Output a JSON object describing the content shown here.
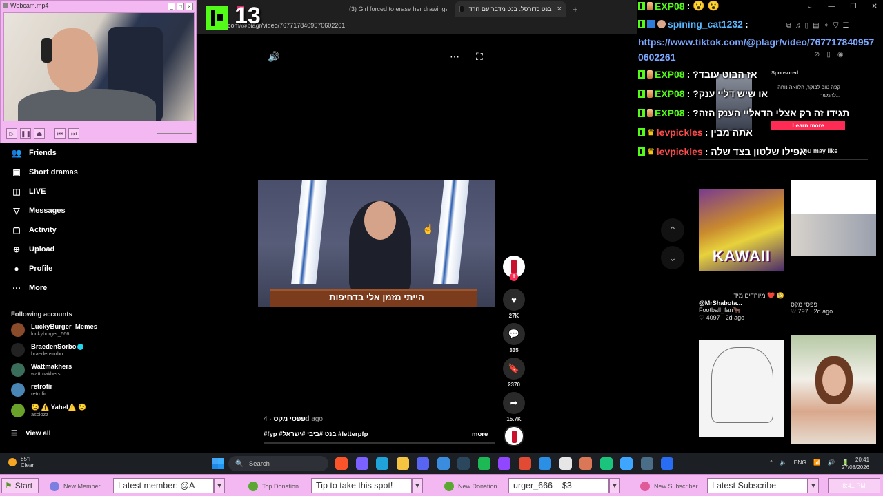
{
  "browser": {
    "tabs": [
      {
        "title": "(3) Girl forced to erase her drawings"
      },
      {
        "title": "בנט כדורסל: בנט מדבר עם חרדי"
      }
    ],
    "url": "com/@plagr/video/7677178409570602261",
    "window_controls": [
      "⌄",
      "—",
      "❐",
      "✕"
    ]
  },
  "stream_overlay": {
    "viewer_count": "13"
  },
  "webcam": {
    "title": "Webcam.mp4",
    "controls": [
      "▷",
      "❚❚",
      "⏏",
      "⏮",
      "⏭"
    ]
  },
  "sidebar": {
    "items": [
      {
        "label": "Friends",
        "icon": "friends-icon",
        "glyph": "👥"
      },
      {
        "label": "Short dramas",
        "icon": "short-dramas-icon",
        "glyph": "▣"
      },
      {
        "label": "LIVE",
        "icon": "live-icon",
        "glyph": "◫"
      },
      {
        "label": "Messages",
        "icon": "messages-icon",
        "glyph": "▽"
      },
      {
        "label": "Activity",
        "icon": "activity-icon",
        "glyph": "▢"
      },
      {
        "label": "Upload",
        "icon": "upload-icon",
        "glyph": "⊕"
      },
      {
        "label": "Profile",
        "icon": "profile-icon",
        "glyph": "●"
      },
      {
        "label": "More",
        "icon": "more-icon",
        "glyph": "⋯"
      }
    ],
    "following_title": "Following accounts",
    "accounts": [
      {
        "name": "LuckyBurger_Memes",
        "handle": "luckyburger_666",
        "color": "#8a4b2a"
      },
      {
        "name": "BraedenSorbo",
        "handle": "braedensorbo",
        "color": "#222222"
      },
      {
        "name": "Wattmakhers",
        "handle": "wattmakhers",
        "color": "#3b6e5a"
      },
      {
        "name": "retrofir",
        "handle": "retrofir",
        "color": "#4a86b5"
      },
      {
        "name": "😉 ⚠️ Yahel⚠️ 😉",
        "handle": "asclozz",
        "color": "#6aa32a"
      }
    ],
    "view_all": "View all",
    "view_all_glyph": "☰"
  },
  "video": {
    "caption_overlay": "הייתי מזמן אלי בדחיפות",
    "author": "פפסי מקס",
    "age": " · 4d ago",
    "tags": "#fyp #בנט #ביבי #ישראל #letterpfp",
    "more": "more",
    "top_icons": {
      "volume": "🔊",
      "options": "⋯",
      "fullscreen": "⛶"
    },
    "rail": {
      "follow_plus": "+",
      "like": {
        "glyph": "♥",
        "count": "27K"
      },
      "comment": {
        "glyph": "💬",
        "count": "335"
      },
      "save": {
        "glyph": "🔖",
        "count": "2370"
      },
      "share": {
        "glyph": "➦",
        "count": "15.7K"
      }
    },
    "nav": {
      "up": "⌃",
      "down": "⌄"
    }
  },
  "right_panel": {
    "sponsored": "Sponsored",
    "ad_text": "קפה טוב לבוקר, הלוואה נוחה להמשך...",
    "learn_more": "Learn more",
    "you_may_like": "You may like",
    "cards": [
      {
        "creator": "מיוחדים מידי ❤️ 🥹",
        "handle": "@MrShabota...",
        "sub": "Football_fan🐂",
        "likes": "4097",
        "age": "2d ago"
      },
      {
        "creator": "פפסי מקס",
        "likes": "797",
        "age": "2d ago"
      }
    ],
    "thumb_titles": {
      "kawaii": "KAWAII"
    }
  },
  "chat": {
    "url": "https://www.tiktok.com/@plagr/video/7677178409570602261",
    "messages": [
      {
        "user": "EXP08",
        "text": ": 😮 😮",
        "user_class": "u-exp",
        "badge": "sub"
      },
      {
        "user": "spining_cat1232",
        "text": ":",
        "user_class": "u-cat",
        "badge": "x"
      },
      {
        "user": "EXP08",
        "text": ": ?אז הבוט עובד",
        "user_class": "u-exp",
        "badge": "sub"
      },
      {
        "user": "EXP08",
        "text": ": ?או שיש דליי ענק",
        "user_class": "u-exp",
        "badge": "sub"
      },
      {
        "user": "EXP08",
        "text": ": ?תגידו זה רק אצלי הדאליי הענק הזה",
        "user_class": "u-exp",
        "badge": "sub"
      },
      {
        "user": "levpickles",
        "text": ": אתה מבין",
        "user_class": "u-lev",
        "badge": "crown"
      },
      {
        "user": "levpickles",
        "text": ": אפילו שלטון בצד שלה",
        "user_class": "u-lev",
        "badge": "crown"
      }
    ]
  },
  "taskbar": {
    "temp": "85°F",
    "weather": "Clear",
    "search": "Search",
    "search_glyph": "🔍",
    "tray_items": [
      "^",
      "🔈",
      "ENG",
      "📶",
      "🔊",
      "🔋"
    ],
    "time": "20:41",
    "date": "27/08/2026",
    "apps": [
      {
        "name": "brave",
        "color": "#fb542b"
      },
      {
        "name": "copilot",
        "color": "#7b61ff"
      },
      {
        "name": "edge",
        "color": "#1fa3d8"
      },
      {
        "name": "files",
        "color": "#f5c542"
      },
      {
        "name": "discord",
        "color": "#5865f2"
      },
      {
        "name": "store",
        "color": "#3a8dde"
      },
      {
        "name": "steam",
        "color": "#2a475e"
      },
      {
        "name": "spotify",
        "color": "#1db954"
      },
      {
        "name": "app-purple",
        "color": "#9146ff"
      },
      {
        "name": "app-red",
        "color": "#e24a33"
      },
      {
        "name": "vscode",
        "color": "#2b8fe6"
      },
      {
        "name": "docs",
        "color": "#e6e6e6"
      },
      {
        "name": "claude",
        "color": "#d97757"
      },
      {
        "name": "app-green",
        "color": "#1bc47d"
      },
      {
        "name": "app-blue",
        "color": "#3ea6ff"
      },
      {
        "name": "steam2",
        "color": "#4a6d88"
      },
      {
        "name": "app-arc",
        "color": "#2a6df5"
      }
    ]
  },
  "infobar": {
    "start": "Start",
    "new_member_label": "New Member",
    "new_member_value": "Latest member: @A",
    "top_donation_label": "Top Donation",
    "top_donation_value": "Tip to take this spot!",
    "new_donation_label": "New Donation",
    "new_donation_value": "urger_666 – $3",
    "new_subscriber_label": "New Subscriber",
    "new_subscriber_value": "Latest Subscribe",
    "clock": "8:41 PM",
    "dropdown_glyph": "▼"
  },
  "colors": {
    "kick_green": "#53fc18",
    "tiktok_red": "#fe2c55",
    "overlay_pink": "#f3b7f1",
    "chat_link": "#7aa7ff"
  }
}
